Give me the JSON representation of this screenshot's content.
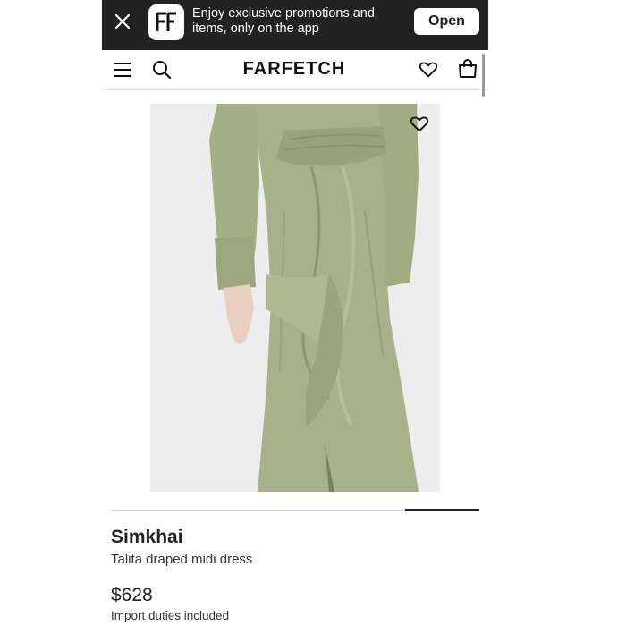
{
  "promo": {
    "close_icon": "close-icon",
    "app_logo_text": "FF",
    "message": "Enjoy exclusive promotions and items, only on the app",
    "open_label": "Open"
  },
  "header": {
    "menu_icon": "hamburger-menu-icon",
    "search_icon": "search-icon",
    "brand": "FARFETCH",
    "wishlist_icon": "heart-icon",
    "bag_icon": "shopping-bag-icon"
  },
  "product": {
    "image_favorite_icon": "heart-icon",
    "designer": "Simkhai",
    "name": "Talita draped midi dress",
    "price": "$628",
    "duties_note": "Import duties included",
    "dress_color": "#a9b18a"
  },
  "colors": {
    "banner_bg": "#222222",
    "text_primary": "#222222",
    "image_bg": "#ececec"
  }
}
